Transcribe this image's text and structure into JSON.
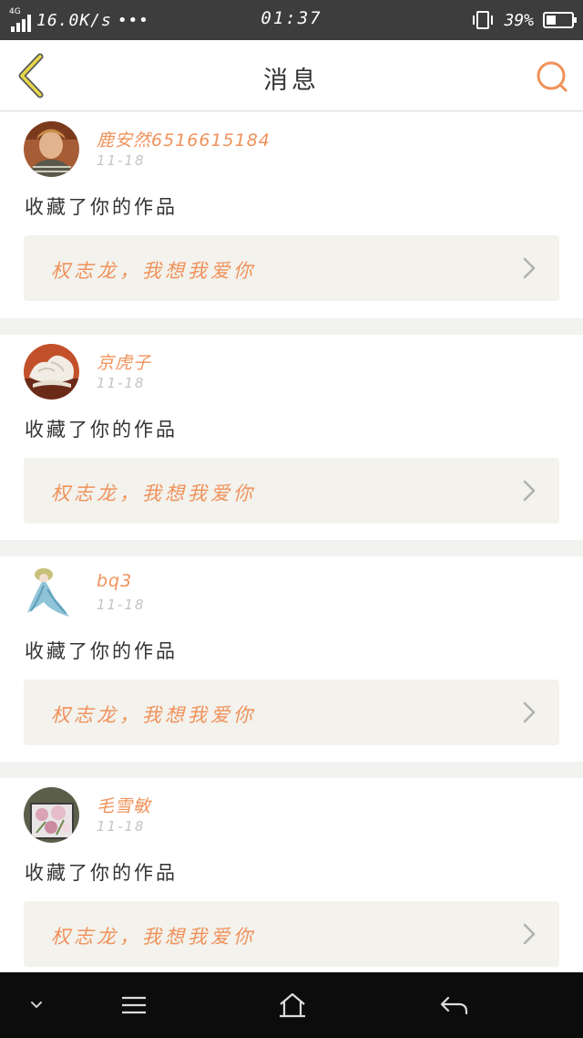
{
  "status_bar": {
    "network": "4G",
    "speed": "16.0K/s",
    "dots": "•••",
    "time": "01:37",
    "battery": "39%",
    "battery_level": 0.39
  },
  "header": {
    "title": "消息",
    "back_icon": "chevron-left-icon",
    "search_icon": "search-icon"
  },
  "messages": [
    {
      "name": "鹿安然6516615184",
      "date": "11-18",
      "action": "收藏了你的作品",
      "work": "权志龙，我想我爱你",
      "avatar": "avatar-person"
    },
    {
      "name": "京虎子",
      "date": "11-18",
      "action": "收藏了你的作品",
      "work": "权志龙，我想我爱你",
      "avatar": "avatar-sculpture"
    },
    {
      "name": "bq3",
      "date": "11-18",
      "action": "收藏了你的作品",
      "work": "权志龙，我想我爱你",
      "avatar": "avatar-fairy"
    },
    {
      "name": "毛雪敏",
      "date": "11-18",
      "action": "收藏了你的作品",
      "work": "权志龙，我想我爱你",
      "avatar": "avatar-flowers"
    }
  ],
  "bottom_nav": {
    "icons": [
      "chevron-down-icon",
      "menu-icon",
      "home-icon",
      "back-arrow-icon"
    ]
  },
  "colors": {
    "accent": "#f0925b",
    "back_icon": "#e8d84a",
    "date": "#c4c4c4"
  }
}
